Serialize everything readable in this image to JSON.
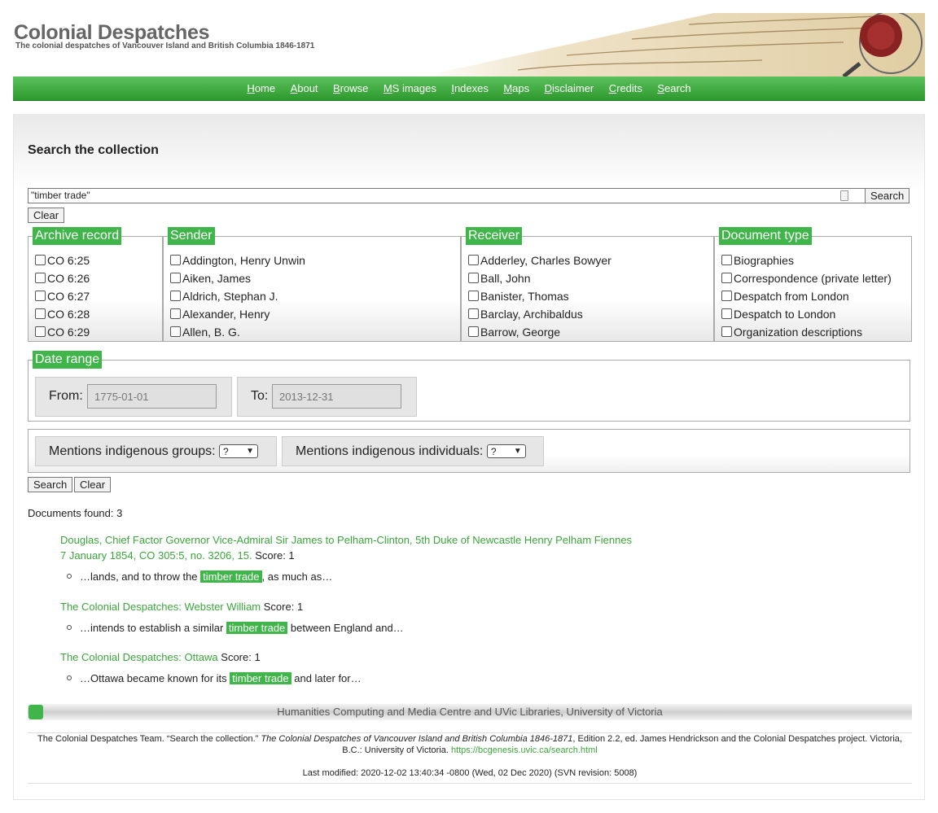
{
  "site": {
    "title": "Colonial Despatches",
    "subtitle": "The colonial despatches of Vancouver Island and British Columbia 1846-1871"
  },
  "nav": [
    {
      "key": "H",
      "rest": "ome"
    },
    {
      "key": "A",
      "rest": "bout"
    },
    {
      "key": "B",
      "rest": "rowse"
    },
    {
      "key": "M",
      "rest": "S images"
    },
    {
      "key": "I",
      "rest": "ndexes"
    },
    {
      "key": "M",
      "rest": "aps"
    },
    {
      "key": "D",
      "rest": "isclaimer"
    },
    {
      "key": "C",
      "rest": "redits"
    },
    {
      "key": "S",
      "rest": "earch"
    }
  ],
  "search": {
    "heading": "Search the collection",
    "query": "\"timber trade\"",
    "search_label": "Search",
    "clear_label": "Clear"
  },
  "facets": {
    "archive": {
      "legend": "Archive record",
      "items": [
        "CO 6:25",
        "CO 6:26",
        "CO 6:27",
        "CO 6:28",
        "CO 6:29"
      ]
    },
    "sender": {
      "legend": "Sender",
      "items": [
        "Addington, Henry Unwin",
        "Aiken, James",
        "Aldrich, Stephan J.",
        "Alexander, Henry",
        "Allen, B. G."
      ]
    },
    "receiver": {
      "legend": "Receiver",
      "items": [
        "Adderley, Charles Bowyer",
        "Ball, John",
        "Banister, Thomas",
        "Barclay, Archibaldus",
        "Barrow, George"
      ]
    },
    "doctype": {
      "legend": "Document type",
      "items": [
        "Biographies",
        "Correspondence (private letter)",
        "Despatch from London",
        "Despatch to London",
        "Organization descriptions"
      ]
    }
  },
  "date_range": {
    "legend": "Date range",
    "from_label": "From:",
    "from_placeholder": "1775-01-01",
    "to_label": "To:",
    "to_placeholder": "2013-12-31"
  },
  "indigenous": {
    "groups_label": "Mentions indigenous groups:",
    "groups_value": "?",
    "individuals_label": "Mentions indigenous individuals:",
    "individuals_value": "?"
  },
  "actions": {
    "search_label": "Search",
    "clear_label": "Clear"
  },
  "results": {
    "found": "Documents found: 3",
    "items": [
      {
        "title_line1": "Douglas, Chief Factor Governor Vice-Admiral Sir James to Pelham-Clinton, 5th Duke of Newcastle Henry Pelham Fiennes",
        "title_line2": "7 January 1854, CO 305:5, no. 3206, 15.",
        "score": "Score: 1",
        "before": "…lands, and to throw the ",
        "hit": "timber trade",
        "after": ", as much as…"
      },
      {
        "title_line1": "The Colonial Despatches: Webster William",
        "score": "Score: 1",
        "before": "…intends to establish a similar ",
        "hit": "timber trade",
        "after": " between England and…"
      },
      {
        "title_line1": "The Colonial Despatches: Ottawa",
        "score": "Score: 1",
        "before": "…Ottawa became known for its ",
        "hit": "timber trade",
        "after": " and later for…"
      }
    ]
  },
  "footer": {
    "bar": "Humanities Computing and Media Centre and UVic Libraries, University of Victoria",
    "cite_pre": "The Colonial Despatches Team. “Search the collection.” ",
    "cite_italic": "The Colonial Despatches of Vancouver Island and British Columbia 1846-1871",
    "cite_post": ", Edition 2.2, ed. James Hendrickson and the Colonial Despatches project. Victoria, B.C.: University of Victoria. ",
    "cite_url": "https://bcgenesis.uvic.ca/search.html",
    "last_modified": "Last modified: 2020-12-02 13:40:34 -0800 (Wed, 02 Dec 2020) (SVN revision: 5008)"
  }
}
